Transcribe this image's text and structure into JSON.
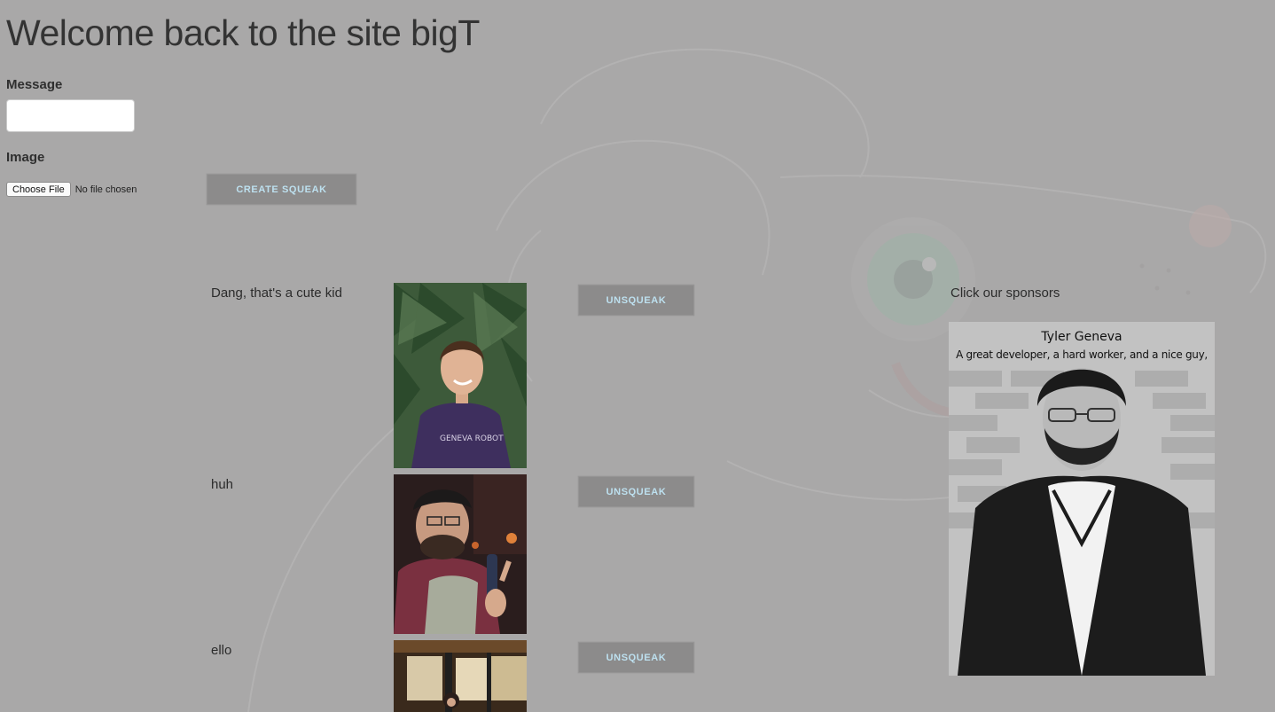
{
  "page": {
    "title": "Welcome back to the site bigT"
  },
  "form": {
    "message_label": "Message",
    "message_value": "",
    "image_label": "Image",
    "choose_file_label": "Choose File",
    "no_file_text": "No file chosen",
    "create_button_label": "CREATE SQUEAK"
  },
  "squeaks": [
    {
      "text": "Dang, that's a cute kid",
      "image": "boy-portrait-photo",
      "unsqueak_label": "UNSQUEAK"
    },
    {
      "text": "huh",
      "image": "man-with-bottle-photo",
      "unsqueak_label": "UNSQUEAK"
    },
    {
      "text": "ello",
      "image": "cafe-interior-photo",
      "unsqueak_label": "UNSQUEAK"
    }
  ],
  "sponsors": {
    "heading": "Click our sponsors",
    "ad": {
      "name": "Tyler Geneva",
      "tagline": "A great developer, a hard worker, and a nice guy,"
    }
  },
  "colors": {
    "background": "#a9a8a8",
    "button_bg": "#8c8b8b",
    "button_text": "#bde0ef"
  }
}
